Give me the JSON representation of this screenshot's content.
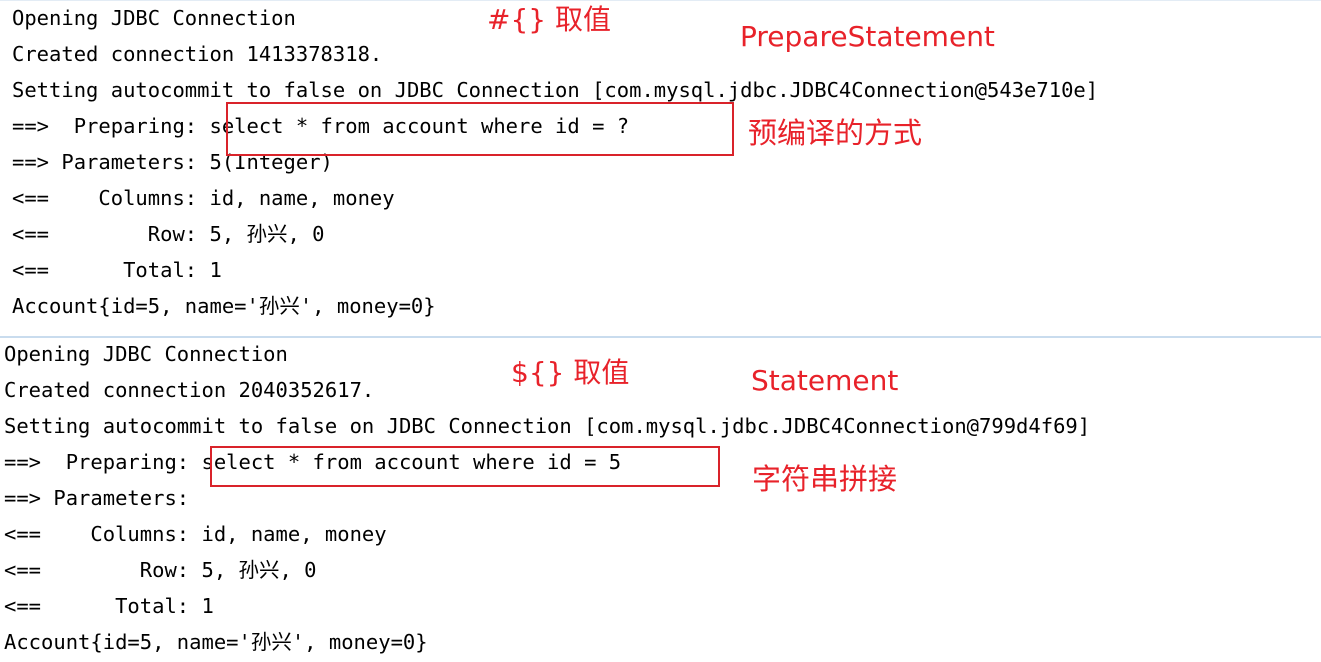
{
  "colors": {
    "annotation": "#e8222a",
    "box": "#d9232a",
    "separator": "#c9dcee",
    "text": "#000000",
    "background": "#ffffff"
  },
  "top": {
    "lines": [
      "Opening JDBC Connection",
      "Created connection 1413378318.",
      "Setting autocommit to false on JDBC Connection [com.mysql.jdbc.JDBC4Connection@543e710e]",
      "==>  Preparing: select * from account where id = ?",
      "==> Parameters: 5(Integer)",
      "<==    Columns: id, name, money",
      "<==        Row: 5, 孙兴, 0",
      "<==      Total: 1",
      "Account{id=5, name='孙兴', money=0}"
    ],
    "annotations": {
      "placeholder": "#{} 取值",
      "statement_type": "PrepareStatement",
      "note": "预编译的方式"
    }
  },
  "bottom": {
    "lines": [
      "Opening JDBC Connection",
      "Created connection 2040352617.",
      "Setting autocommit to false on JDBC Connection [com.mysql.jdbc.JDBC4Connection@799d4f69]",
      "==>  Preparing: select * from account where id = 5",
      "==> Parameters: ",
      "<==    Columns: id, name, money",
      "<==        Row: 5, 孙兴, 0",
      "<==      Total: 1",
      "Account{id=5, name='孙兴', money=0}"
    ],
    "annotations": {
      "placeholder": "${} 取值",
      "statement_type": "Statement",
      "note": "字符串拼接"
    }
  }
}
